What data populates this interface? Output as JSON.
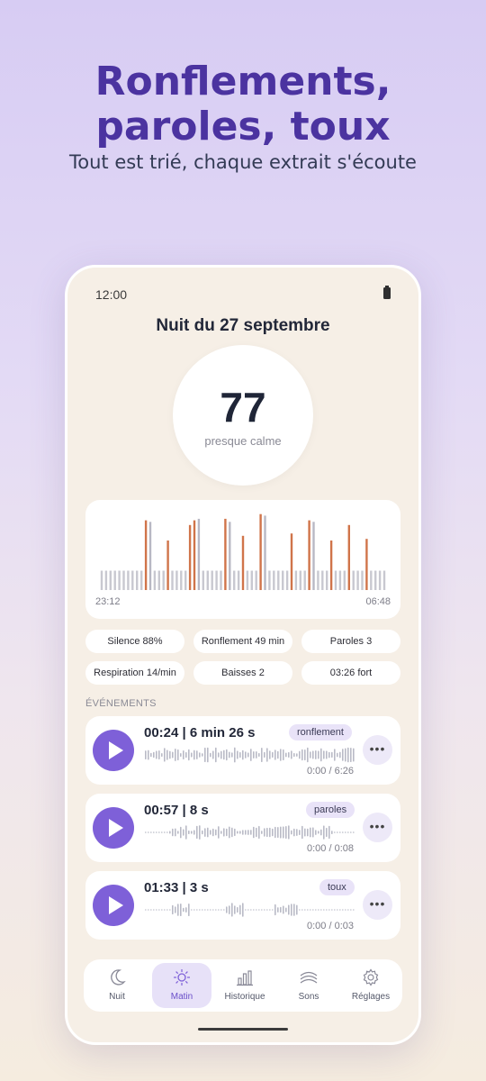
{
  "promo": {
    "headline_line1": "Ronflements,",
    "headline_line2": "paroles, toux",
    "subheadline": "Tout est trié, chaque extrait s'écoute"
  },
  "status_bar": {
    "time": "12:00"
  },
  "night": {
    "title": "Nuit du 27 septembre",
    "score": "77",
    "score_label": "presque calme"
  },
  "chart_data": {
    "type": "bar",
    "x_start_label": "23:12",
    "x_end_label": "06:48",
    "series_colors": {
      "baseline": "#c8c8d0",
      "snore": "#d0744a",
      "peak": "#b8b8c4"
    },
    "values": [
      0.25,
      0.25,
      0.25,
      0.25,
      0.25,
      0.25,
      0.25,
      0.25,
      0.25,
      0.25,
      0.9,
      0.88,
      0.25,
      0.25,
      0.25,
      0.64,
      0.25,
      0.25,
      0.25,
      0.25,
      0.84,
      0.9,
      0.92,
      0.25,
      0.25,
      0.25,
      0.25,
      0.25,
      0.92,
      0.88,
      0.25,
      0.25,
      0.7,
      0.25,
      0.25,
      0.25,
      0.98,
      0.96,
      0.25,
      0.25,
      0.25,
      0.25,
      0.25,
      0.73,
      0.25,
      0.25,
      0.25,
      0.9,
      0.88,
      0.25,
      0.25,
      0.25,
      0.64,
      0.25,
      0.25,
      0.25,
      0.84,
      0.25,
      0.25,
      0.25,
      0.66,
      0.25,
      0.25,
      0.25,
      0.25
    ],
    "snore_indices": [
      10,
      15,
      20,
      21,
      28,
      32,
      36,
      43,
      47,
      52,
      56,
      60
    ]
  },
  "stats": [
    "Silence 88%",
    "Ronflement 49 min",
    "Paroles 3",
    "Respiration 14/min",
    "Baisses 2",
    "03:26 fort"
  ],
  "events_section_label": "ÉVÉNEMENTS",
  "events": [
    {
      "title": "00:24  |  6 min 26 s",
      "tag": "ronflement",
      "playback": "0:00 / 6:26",
      "wave_density": 1.0
    },
    {
      "title": "00:57  |  8 s",
      "tag": "paroles",
      "playback": "0:00 / 0:08",
      "wave_density": 0.7
    },
    {
      "title": "01:33  |  3 s",
      "tag": "toux",
      "playback": "0:00 / 0:03",
      "wave_density": 0.4
    }
  ],
  "more_label": "•••",
  "nav": {
    "items": [
      {
        "label": "Nuit",
        "icon": "moon-icon"
      },
      {
        "label": "Matin",
        "icon": "sun-icon"
      },
      {
        "label": "Historique",
        "icon": "bar-chart-icon"
      },
      {
        "label": "Sons",
        "icon": "waves-icon"
      },
      {
        "label": "Réglages",
        "icon": "gear-icon"
      }
    ],
    "active_index": 1
  },
  "colors": {
    "accent": "#7e60d8",
    "headline": "#4b33a0",
    "snore_bar": "#d0744a"
  }
}
